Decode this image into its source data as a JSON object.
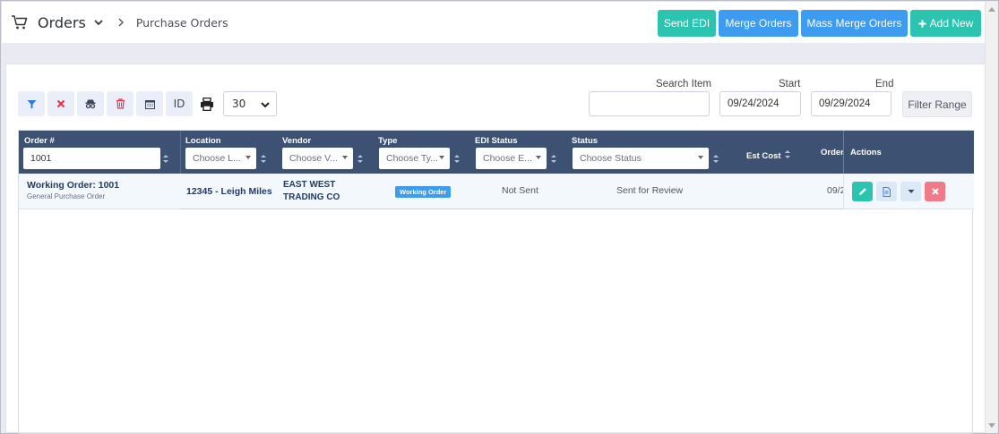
{
  "breadcrumb": {
    "title": "Orders",
    "subpage": "Purchase Orders"
  },
  "top_buttons": {
    "send_edi": "Send EDI",
    "merge_orders": "Merge Orders",
    "mass_merge_orders": "Mass Merge Orders",
    "add_new": "Add New"
  },
  "toolbar": {
    "id_label": "ID",
    "per_page": "30"
  },
  "search": {
    "search_item_label": "Search Item",
    "search_item_value": "",
    "start_label": "Start",
    "start_value": "09/24/2024",
    "end_label": "End",
    "end_value": "09/29/2024",
    "filter_range": "Filter Range"
  },
  "table": {
    "columns": {
      "order_no": "Order #",
      "location": "Location",
      "vendor": "Vendor",
      "type": "Type",
      "edi_status": "EDI Status",
      "status": "Status",
      "est_cost": "Est Cost",
      "order_date": "Order",
      "actions": "Actions"
    },
    "filters": {
      "order_no": "1001",
      "location": "Choose L...",
      "vendor": "Choose V...",
      "type": "Choose Ty...",
      "edi_status": "Choose E...",
      "status": "Choose Status"
    },
    "rows": [
      {
        "order_title": "Working Order: 1001",
        "order_subtitle": "General Purchase Order",
        "location": "12345 - Leigh Miles",
        "vendor_line1": "EAST WEST",
        "vendor_line2": "TRADING CO",
        "type_badge": "Working Order",
        "edi_status": "Not Sent",
        "status": "Sent for Review",
        "order_date": "09/2"
      }
    ]
  },
  "colors": {
    "teal": "#2cc3b0",
    "blue": "#3d9cf0",
    "header": "#3d5272",
    "danger": "#f07a8a"
  },
  "icons": [
    "cart-icon",
    "chevron-down-icon",
    "chevron-right-icon",
    "filter-icon",
    "clear-icon",
    "spy-icon",
    "trash-icon",
    "calendar-icon",
    "printer-icon",
    "pencil-icon",
    "document-icon",
    "caret-down-icon",
    "close-icon",
    "plus-icon"
  ]
}
